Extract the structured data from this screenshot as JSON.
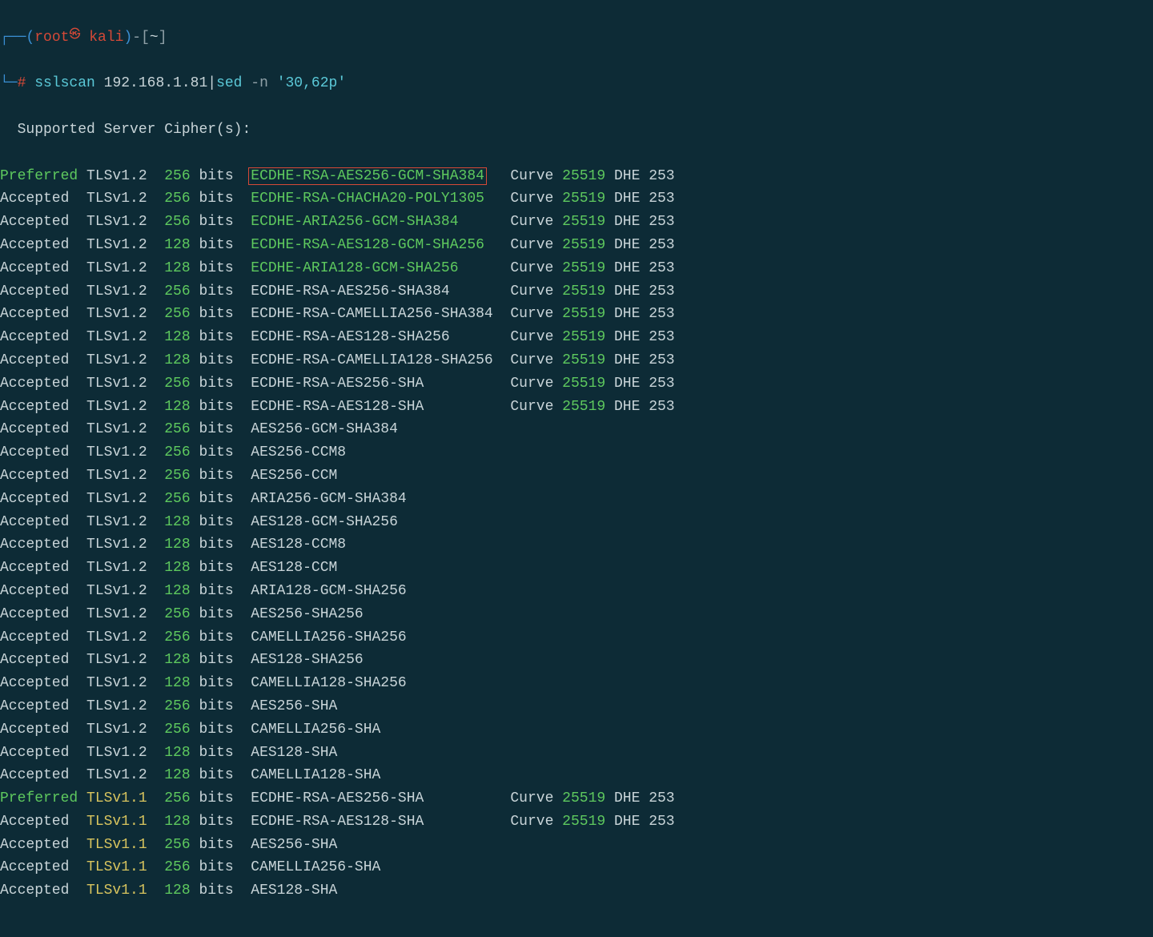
{
  "prompt": {
    "open_paren": "(",
    "user": "root",
    "skull": "㉿",
    "host": " kali",
    "close_paren": ")",
    "dash_open": "-[",
    "cwd": "~",
    "close_bracket": "]",
    "tree_top": "┌──",
    "tree_bot": "└─",
    "hash": "#",
    "cmd1": " sslscan ",
    "arg1": "192.168.1.81",
    "pipe": "|",
    "cmd2": "sed ",
    "flag": "-n ",
    "arg2": "'30,62p'"
  },
  "header": "  Supported Server Cipher(s):",
  "cols": {
    "curve_label": "Curve ",
    "dhe_label": " DHE "
  },
  "rows": [
    {
      "status": "Preferred",
      "tls": "TLSv1.2",
      "bits": "256",
      "cipher": "ECDHE-RSA-AES256-GCM-SHA384",
      "cipher_color": "green",
      "tls_color": "white",
      "curve": "25519",
      "dhe": "253",
      "highlight": true
    },
    {
      "status": "Accepted",
      "tls": "TLSv1.2",
      "bits": "256",
      "cipher": "ECDHE-RSA-CHACHA20-POLY1305",
      "cipher_color": "green",
      "tls_color": "white",
      "curve": "25519",
      "dhe": "253"
    },
    {
      "status": "Accepted",
      "tls": "TLSv1.2",
      "bits": "256",
      "cipher": "ECDHE-ARIA256-GCM-SHA384",
      "cipher_color": "green",
      "tls_color": "white",
      "curve": "25519",
      "dhe": "253"
    },
    {
      "status": "Accepted",
      "tls": "TLSv1.2",
      "bits": "128",
      "cipher": "ECDHE-RSA-AES128-GCM-SHA256",
      "cipher_color": "green",
      "tls_color": "white",
      "curve": "25519",
      "dhe": "253"
    },
    {
      "status": "Accepted",
      "tls": "TLSv1.2",
      "bits": "128",
      "cipher": "ECDHE-ARIA128-GCM-SHA256",
      "cipher_color": "green",
      "tls_color": "white",
      "curve": "25519",
      "dhe": "253"
    },
    {
      "status": "Accepted",
      "tls": "TLSv1.2",
      "bits": "256",
      "cipher": "ECDHE-RSA-AES256-SHA384",
      "cipher_color": "white",
      "tls_color": "white",
      "curve": "25519",
      "dhe": "253"
    },
    {
      "status": "Accepted",
      "tls": "TLSv1.2",
      "bits": "256",
      "cipher": "ECDHE-RSA-CAMELLIA256-SHA384",
      "cipher_color": "white",
      "tls_color": "white",
      "curve": "25519",
      "dhe": "253"
    },
    {
      "status": "Accepted",
      "tls": "TLSv1.2",
      "bits": "128",
      "cipher": "ECDHE-RSA-AES128-SHA256",
      "cipher_color": "white",
      "tls_color": "white",
      "curve": "25519",
      "dhe": "253"
    },
    {
      "status": "Accepted",
      "tls": "TLSv1.2",
      "bits": "128",
      "cipher": "ECDHE-RSA-CAMELLIA128-SHA256",
      "cipher_color": "white",
      "tls_color": "white",
      "curve": "25519",
      "dhe": "253"
    },
    {
      "status": "Accepted",
      "tls": "TLSv1.2",
      "bits": "256",
      "cipher": "ECDHE-RSA-AES256-SHA",
      "cipher_color": "white",
      "tls_color": "white",
      "curve": "25519",
      "dhe": "253"
    },
    {
      "status": "Accepted",
      "tls": "TLSv1.2",
      "bits": "128",
      "cipher": "ECDHE-RSA-AES128-SHA",
      "cipher_color": "white",
      "tls_color": "white",
      "curve": "25519",
      "dhe": "253"
    },
    {
      "status": "Accepted",
      "tls": "TLSv1.2",
      "bits": "256",
      "cipher": "AES256-GCM-SHA384",
      "cipher_color": "white",
      "tls_color": "white"
    },
    {
      "status": "Accepted",
      "tls": "TLSv1.2",
      "bits": "256",
      "cipher": "AES256-CCM8",
      "cipher_color": "white",
      "tls_color": "white"
    },
    {
      "status": "Accepted",
      "tls": "TLSv1.2",
      "bits": "256",
      "cipher": "AES256-CCM",
      "cipher_color": "white",
      "tls_color": "white"
    },
    {
      "status": "Accepted",
      "tls": "TLSv1.2",
      "bits": "256",
      "cipher": "ARIA256-GCM-SHA384",
      "cipher_color": "white",
      "tls_color": "white"
    },
    {
      "status": "Accepted",
      "tls": "TLSv1.2",
      "bits": "128",
      "cipher": "AES128-GCM-SHA256",
      "cipher_color": "white",
      "tls_color": "white"
    },
    {
      "status": "Accepted",
      "tls": "TLSv1.2",
      "bits": "128",
      "cipher": "AES128-CCM8",
      "cipher_color": "white",
      "tls_color": "white"
    },
    {
      "status": "Accepted",
      "tls": "TLSv1.2",
      "bits": "128",
      "cipher": "AES128-CCM",
      "cipher_color": "white",
      "tls_color": "white"
    },
    {
      "status": "Accepted",
      "tls": "TLSv1.2",
      "bits": "128",
      "cipher": "ARIA128-GCM-SHA256",
      "cipher_color": "white",
      "tls_color": "white"
    },
    {
      "status": "Accepted",
      "tls": "TLSv1.2",
      "bits": "256",
      "cipher": "AES256-SHA256",
      "cipher_color": "white",
      "tls_color": "white"
    },
    {
      "status": "Accepted",
      "tls": "TLSv1.2",
      "bits": "256",
      "cipher": "CAMELLIA256-SHA256",
      "cipher_color": "white",
      "tls_color": "white"
    },
    {
      "status": "Accepted",
      "tls": "TLSv1.2",
      "bits": "128",
      "cipher": "AES128-SHA256",
      "cipher_color": "white",
      "tls_color": "white"
    },
    {
      "status": "Accepted",
      "tls": "TLSv1.2",
      "bits": "128",
      "cipher": "CAMELLIA128-SHA256",
      "cipher_color": "white",
      "tls_color": "white"
    },
    {
      "status": "Accepted",
      "tls": "TLSv1.2",
      "bits": "256",
      "cipher": "AES256-SHA",
      "cipher_color": "white",
      "tls_color": "white"
    },
    {
      "status": "Accepted",
      "tls": "TLSv1.2",
      "bits": "256",
      "cipher": "CAMELLIA256-SHA",
      "cipher_color": "white",
      "tls_color": "white"
    },
    {
      "status": "Accepted",
      "tls": "TLSv1.2",
      "bits": "128",
      "cipher": "AES128-SHA",
      "cipher_color": "white",
      "tls_color": "white"
    },
    {
      "status": "Accepted",
      "tls": "TLSv1.2",
      "bits": "128",
      "cipher": "CAMELLIA128-SHA",
      "cipher_color": "white",
      "tls_color": "white"
    },
    {
      "status": "Preferred",
      "tls": "TLSv1.1",
      "bits": "256",
      "cipher": "ECDHE-RSA-AES256-SHA",
      "cipher_color": "white",
      "tls_color": "yellow",
      "curve": "25519",
      "dhe": "253"
    },
    {
      "status": "Accepted",
      "tls": "TLSv1.1",
      "bits": "128",
      "cipher": "ECDHE-RSA-AES128-SHA",
      "cipher_color": "white",
      "tls_color": "yellow",
      "curve": "25519",
      "dhe": "253"
    },
    {
      "status": "Accepted",
      "tls": "TLSv1.1",
      "bits": "256",
      "cipher": "AES256-SHA",
      "cipher_color": "white",
      "tls_color": "yellow"
    },
    {
      "status": "Accepted",
      "tls": "TLSv1.1",
      "bits": "256",
      "cipher": "CAMELLIA256-SHA",
      "cipher_color": "white",
      "tls_color": "yellow"
    },
    {
      "status": "Accepted",
      "tls": "TLSv1.1",
      "bits": "128",
      "cipher": "AES128-SHA",
      "cipher_color": "white",
      "tls_color": "yellow"
    }
  ],
  "bits_label": " bits  "
}
